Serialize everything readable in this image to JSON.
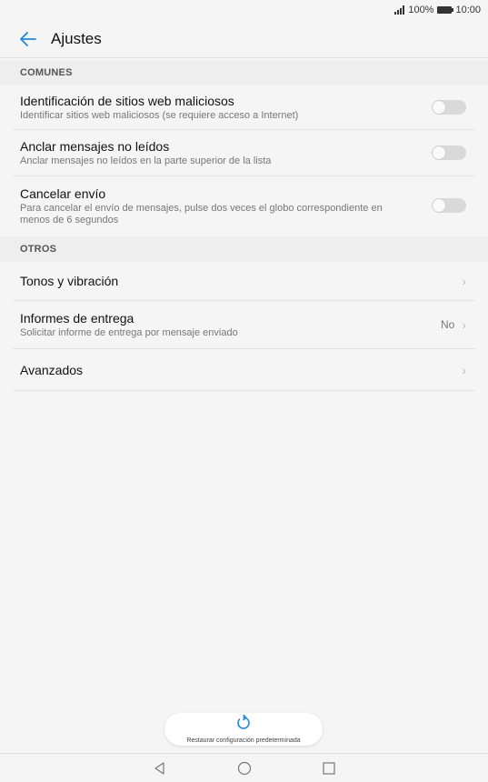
{
  "status_bar": {
    "battery": "100%",
    "time": "10:00"
  },
  "header": {
    "title": "Ajustes"
  },
  "sections": {
    "comunes": "COMUNES",
    "otros": "OTROS"
  },
  "rows": {
    "malicious_sites": {
      "title": "Identificación de sitios web maliciosos",
      "subtitle": "Identificar sitios web maliciosos (se requiere acceso a Internet)",
      "enabled": false
    },
    "pin_unread": {
      "title": "Anclar mensajes no leídos",
      "subtitle": "Anclar mensajes no leídos en la parte superior de la lista",
      "enabled": false
    },
    "cancel_send": {
      "title": "Cancelar envío",
      "subtitle_line1": "Para cancelar el envío de mensajes, pulse dos veces el globo correspondiente en",
      "subtitle_line2": "menos de 6 segundos",
      "enabled": false
    },
    "tones": {
      "title": "Tonos y vibración"
    },
    "delivery_reports": {
      "title": "Informes de entrega",
      "subtitle": "Solicitar informe de entrega por mensaje enviado",
      "value": "No"
    },
    "advanced": {
      "title": "Avanzados"
    }
  },
  "restore": {
    "label": "Restaurar configuración predeterminada",
    "icon": "restore-icon"
  },
  "colors": {
    "accent": "#1e88e5",
    "toggle_off": "#d9d9d9",
    "background": "#f5f5f5"
  }
}
